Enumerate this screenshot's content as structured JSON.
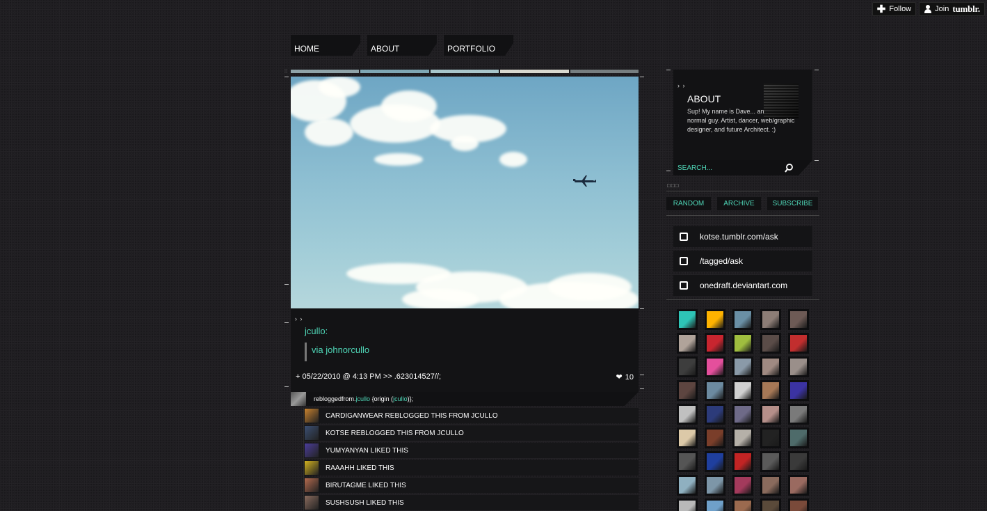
{
  "tumblr_controls": {
    "follow_label": "Follow",
    "join_label": "Join",
    "brand": "tumblr."
  },
  "nav": {
    "items": [
      "HOME",
      "ABOUT",
      "PORTFOLIO"
    ]
  },
  "post": {
    "thumb_colors": [
      "#8fa3a8",
      "#7fa7b4",
      "#a9c6cb",
      "#d8d8cf",
      "#777e80"
    ],
    "caption_user": "jcullo:",
    "caption_quote": "via johnorcullo",
    "meta_date": "+ 05/22/2010 @ 4:13 PM >> .623014527//;",
    "like_count": "10",
    "reblog": {
      "prefix": "rebloggedfrom.",
      "user": "jcullo",
      "origin_prefix": " {origin (",
      "origin_user": "jcullo",
      "origin_suffix": ")};"
    },
    "notes": [
      "CARDIGANWEAR REBLOGGED THIS FROM JCULLO",
      "KOTSE REBLOGGED THIS FROM JCULLO",
      "YUMYANYAN LIKED THIS",
      "RAAAHH LIKED THIS",
      "BIRUTAGME LIKED THIS",
      "SUSHSUSH LIKED THIS"
    ],
    "note_avatar_colors": [
      "#c9822f",
      "#3b4f73",
      "#4b3d9a",
      "#d4b320",
      "#b46a4e",
      "#8a6b5d"
    ]
  },
  "sidebar": {
    "about_title": "ABOUT",
    "about_text": "Sup! My name is Dave... and stuff. I'm a normal guy. Artist, dancer, web/graphic designer, and future Architect. :)",
    "search_placeholder": "SEARCH...",
    "buttons": [
      "RANDOM",
      "ARCHIVE",
      "SUBSCRIBE"
    ],
    "links": [
      "kotse.tumblr.com/ask",
      "/tagged/ask",
      "onedraft.deviantart.com"
    ],
    "follower_avatar_colors": [
      "#2ec4b6",
      "#ffb300",
      "#6a8fa5",
      "#8c7d76",
      "#6d5a55",
      "#b0a39a",
      "#c8252f",
      "#9fbd3f",
      "#5a4c48",
      "#c22e2e",
      "#3d3d3d",
      "#e44f9c",
      "#8a9aa8",
      "#a08a82",
      "#9a8f8a",
      "#5d4540",
      "#6c8aa0",
      "#d0d0d0",
      "#a67856",
      "#3b33a3",
      "#c0c0c0",
      "#2c3b7a",
      "#6e6a88",
      "#b58f8a",
      "#7a7a7a",
      "#dcc9a8",
      "#7a3e2a",
      "#b5b0a8",
      "#222222",
      "#4e6b6a",
      "#555555",
      "#1f3f9e",
      "#c22424",
      "#5a5a5a",
      "#3a3a3a",
      "#8fb0c0",
      "#7d96a8",
      "#a33a5c",
      "#8a6b5d",
      "#9a6a60",
      "#b9b9b9",
      "#6fa0c9",
      "#9b6a4f",
      "#5a4a3a",
      "#7a4a3a"
    ]
  }
}
